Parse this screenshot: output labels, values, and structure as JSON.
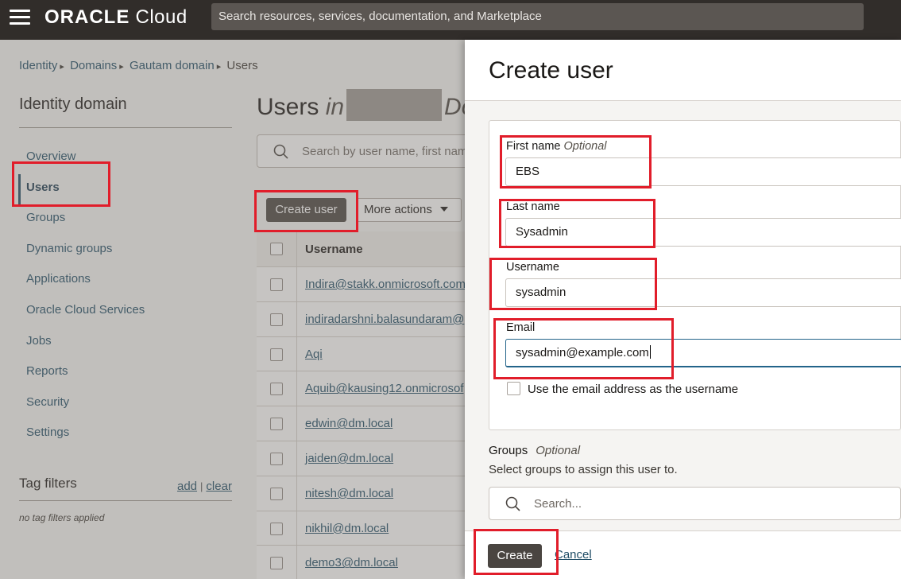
{
  "header": {
    "brand_bold": "ORACLE",
    "brand_light": "Cloud",
    "search_placeholder": "Search resources, services, documentation, and Marketplace"
  },
  "breadcrumb": [
    "Identity",
    "Domains",
    "Gautam domain",
    "Users"
  ],
  "sidebar": {
    "title": "Identity domain",
    "items": [
      {
        "label": "Overview",
        "active": false
      },
      {
        "label": "Users",
        "active": true
      },
      {
        "label": "Groups",
        "active": false
      },
      {
        "label": "Dynamic groups",
        "active": false
      },
      {
        "label": "Applications",
        "active": false
      },
      {
        "label": "Oracle Cloud Services",
        "active": false
      },
      {
        "label": "Jobs",
        "active": false
      },
      {
        "label": "Reports",
        "active": false
      },
      {
        "label": "Security",
        "active": false
      },
      {
        "label": "Settings",
        "active": false
      }
    ],
    "tag_filters": {
      "title": "Tag filters",
      "add": "add",
      "clear": "clear",
      "empty": "no tag filters applied"
    }
  },
  "main": {
    "title_prefix": "Users",
    "title_in": "in",
    "title_suffix": "Do",
    "search_placeholder": "Search by user name, first name",
    "create_button": "Create user",
    "more_actions": "More actions",
    "table": {
      "column": "Username",
      "rows": [
        "Indira@stakk.onmicrosoft.com",
        "indiradarshni.balasundaram@",
        "Aqi",
        "Aquib@kausing12.onmicrosof",
        "edwin@dm.local",
        "jaiden@dm.local",
        "nitesh@dm.local",
        "nikhil@dm.local",
        "demo3@dm.local"
      ]
    }
  },
  "drawer": {
    "title": "Create user",
    "first_name": {
      "label": "First name",
      "optional": "Optional",
      "value": "EBS"
    },
    "last_name": {
      "label": "Last name",
      "value": "Sysadmin"
    },
    "username": {
      "label": "Username",
      "value": "sysadmin"
    },
    "email": {
      "label": "Email",
      "value": "sysadmin@example.com"
    },
    "use_email_checkbox": {
      "label": "Use the email address as the username",
      "checked": false
    },
    "groups": {
      "label": "Groups",
      "optional": "Optional",
      "help": "Select groups to assign this user to.",
      "search_placeholder": "Search..."
    },
    "create_button": "Create",
    "cancel_link": "Cancel"
  },
  "colors": {
    "header_bg": "#312d2a",
    "link": "#1f4d66",
    "button_dark": "#4a4541",
    "highlight": "#e11d2a"
  }
}
